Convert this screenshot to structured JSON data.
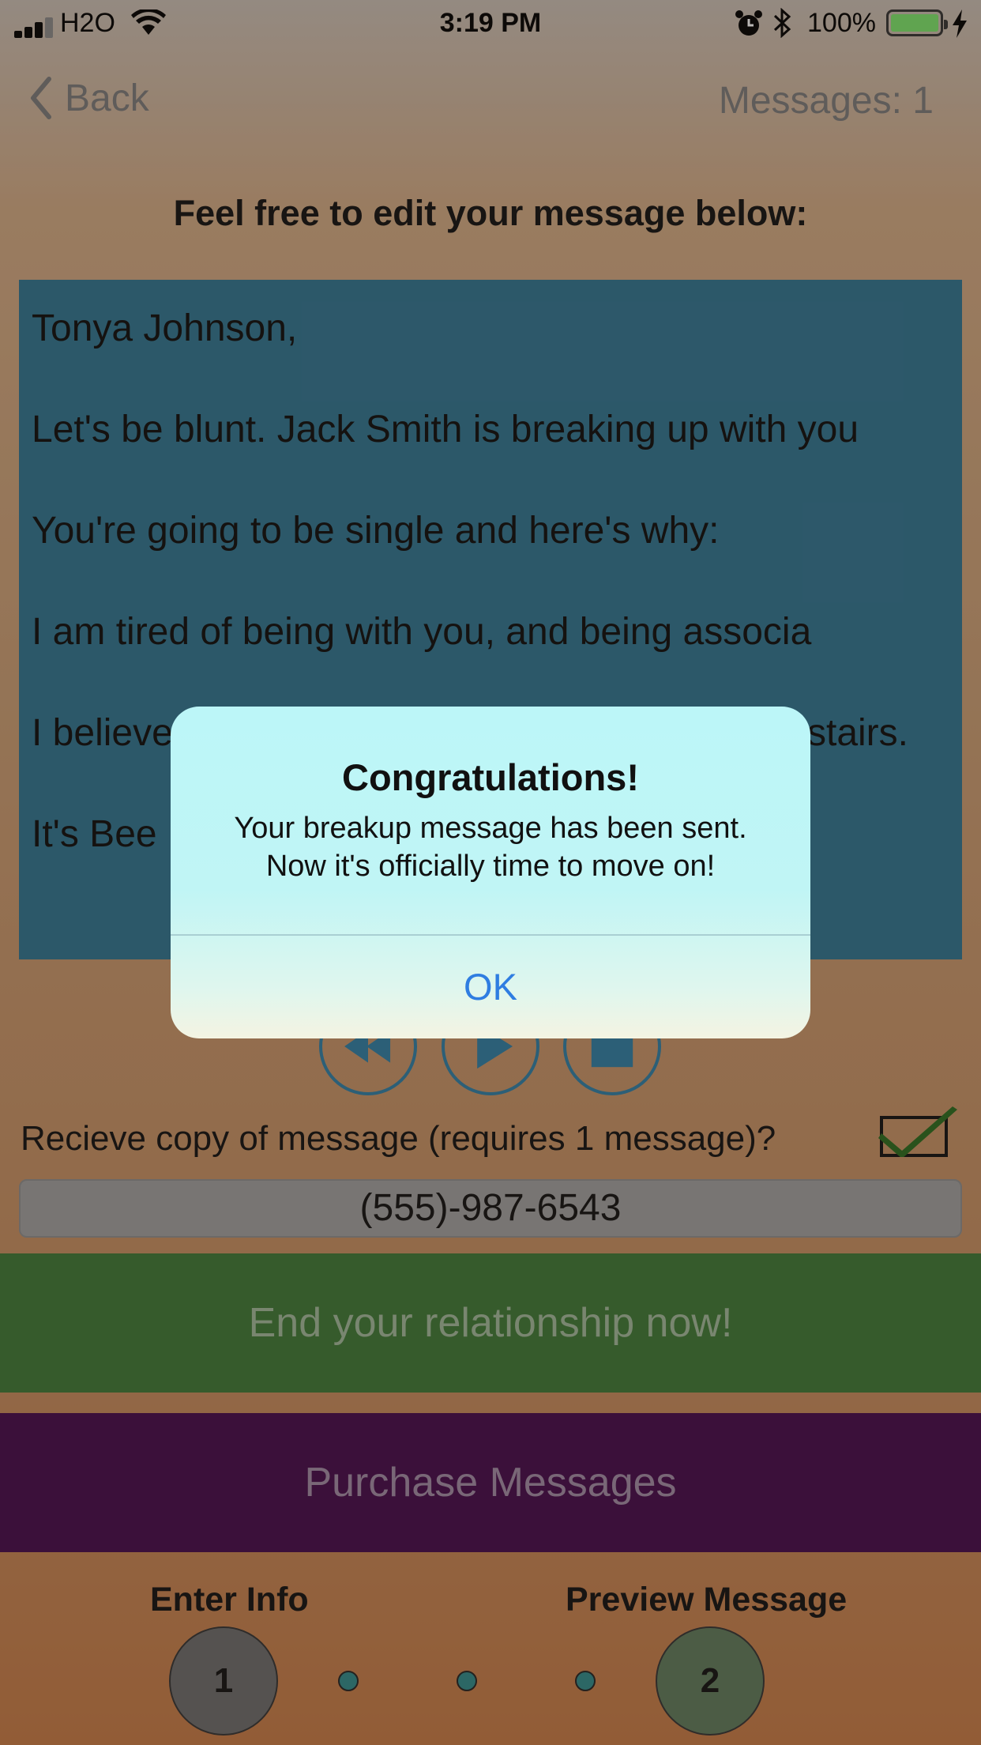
{
  "status_bar": {
    "carrier": "H2O",
    "time": "3:19 PM",
    "battery_percent": "100%",
    "battery_level": 1.0
  },
  "nav": {
    "back_label": "Back",
    "message_count": "Messages: 1"
  },
  "heading": "Feel free to edit your message below:",
  "message": {
    "paragraphs": [
      "Tonya Johnson,",
      "Let's be blunt. Jack Smith is breaking up with you",
      "You're going to be single and here's why:",
      "I am tired of being with you, and being associa",
      "I believe",
      "It's Bee"
    ],
    "visible_right_fragment": "stairs."
  },
  "playback": {
    "icons": [
      "rewind-icon",
      "play-icon",
      "stop-icon"
    ]
  },
  "receive_copy": {
    "label": "Recieve copy of message (requires 1 message)?",
    "checked": true
  },
  "phone_field": {
    "value": "(555)-987-6543"
  },
  "buttons": {
    "end_relationship": "End your relationship now!",
    "purchase": "Purchase Messages"
  },
  "steps": {
    "step1_label": "Enter Info",
    "step1_number": "1",
    "step2_label": "Preview Message",
    "step2_number": "2"
  },
  "alert": {
    "title": "Congratulations!",
    "message_line1": "Your breakup message has been sent.",
    "message_line2": "Now it's officially time to move on!",
    "ok_label": "OK"
  },
  "colors": {
    "textbox_bg": "#2f7490",
    "end_button_bg": "#3d7835",
    "purchase_button_bg": "#450a4a",
    "alert_button": "#2f7de1"
  }
}
